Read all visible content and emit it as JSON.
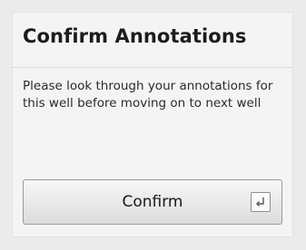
{
  "panel": {
    "title": "Confirm Annotations",
    "message": "Please look through your annotations for this well before moving on to next well",
    "confirm_button": {
      "label": "Confirm",
      "shortcut_icon": "enter-key-icon"
    }
  }
}
